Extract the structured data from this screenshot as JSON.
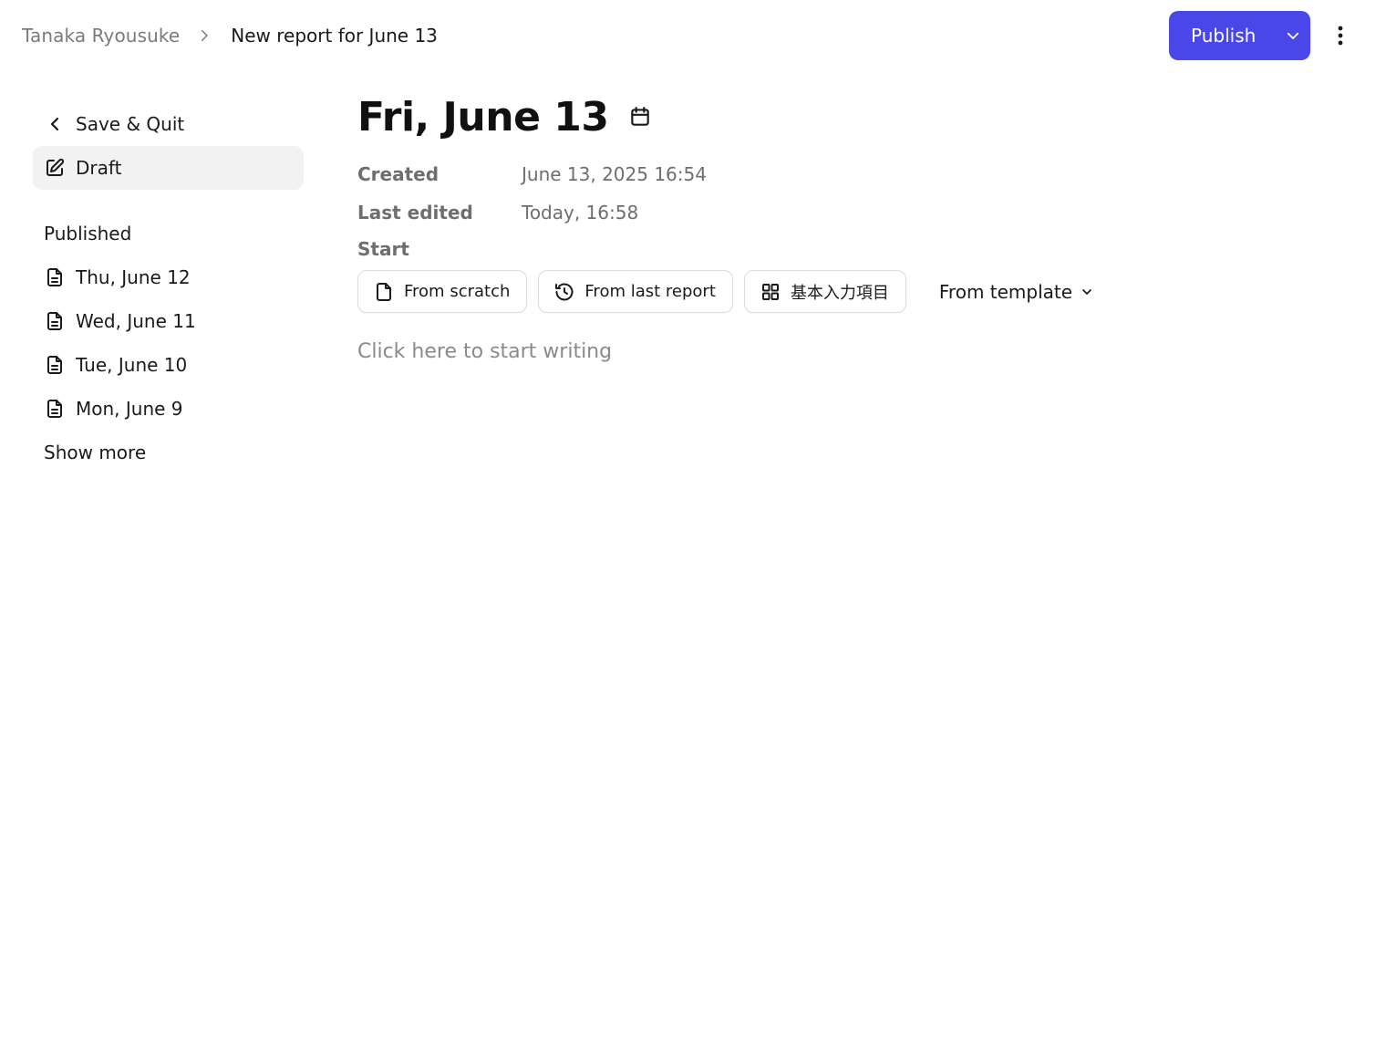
{
  "header": {
    "breadcrumb_parent": "Tanaka Ryousuke",
    "breadcrumb_current": "New report for June 13",
    "publish_label": "Publish"
  },
  "sidebar": {
    "save_quit_label": "Save & Quit",
    "draft_label": "Draft",
    "published_heading": "Published",
    "published_items": [
      {
        "label": "Thu, June 12"
      },
      {
        "label": "Wed, June 11"
      },
      {
        "label": "Tue, June 10"
      },
      {
        "label": "Mon, June 9"
      }
    ],
    "show_more_label": "Show more"
  },
  "main": {
    "title": "Fri, June 13",
    "created_label": "Created",
    "created_value": "June 13, 2025 16:54",
    "last_edited_label": "Last edited",
    "last_edited_value": "Today, 16:58",
    "start_label": "Start",
    "start_options": {
      "from_scratch": "From scratch",
      "from_last_report": "From last report",
      "basic_items": "基本入力項目"
    },
    "from_template_label": "From template",
    "writing_placeholder": "Click here to start writing"
  },
  "colors": {
    "accent": "#4a47e8",
    "muted_text": "#6e6e6e",
    "active_bg": "#f2f2f2"
  }
}
